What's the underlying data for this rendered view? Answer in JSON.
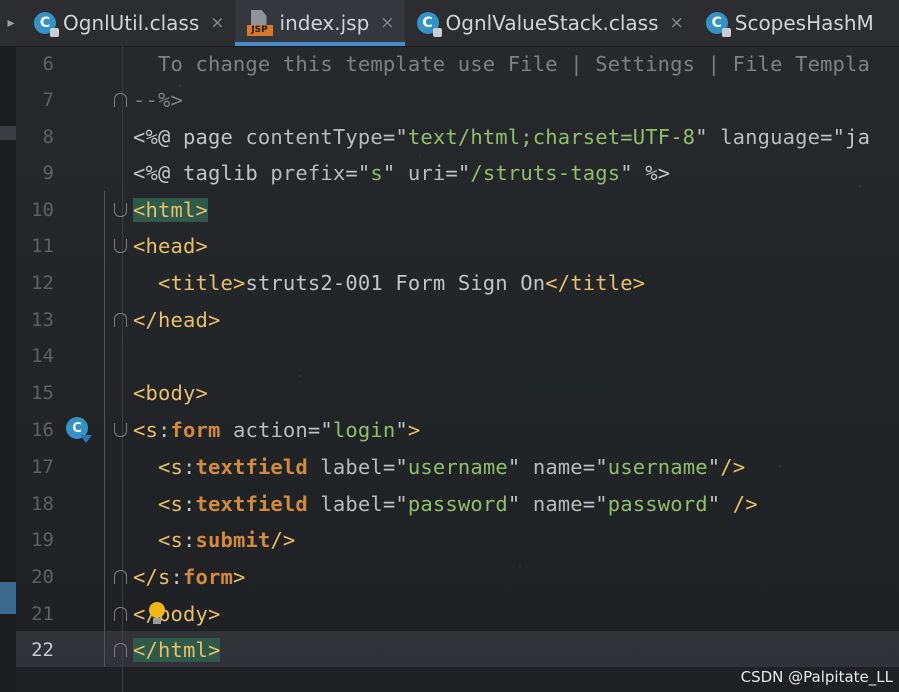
{
  "tabs": [
    {
      "label": "OgnlUtil.class",
      "icon": "class-icon",
      "active": false
    },
    {
      "label": "index.jsp",
      "icon": "jsp-file-icon",
      "active": true
    },
    {
      "label": "OgnlValueStack.class",
      "icon": "class-icon",
      "active": false
    },
    {
      "label": "ScopesHashM",
      "icon": "class-icon",
      "active": false
    }
  ],
  "tab_close_glyph": "×",
  "icons": {
    "class_letter": "C",
    "jsp_badge": "JSP",
    "struts_letter": "C"
  },
  "colors": {
    "accent": "#4a88c7",
    "tag": "#e8bf6a",
    "keyword": "#d28a3e",
    "string": "#8fbf6a"
  },
  "lines": [
    {
      "number": "6",
      "text": "  To change this template use File | Settings | File Templa"
    },
    {
      "number": "7",
      "text": "--%>"
    },
    {
      "number": "8",
      "text": "<%@ page contentType=\"text/html;charset=UTF-8\" language=\"ja"
    },
    {
      "number": "9",
      "text": "<%@ taglib prefix=\"s\" uri=\"/struts-tags\" %>"
    },
    {
      "number": "10",
      "text": "<html>"
    },
    {
      "number": "11",
      "text": "<head>"
    },
    {
      "number": "12",
      "text": "  <title>struts2-001 Form Sign On</title>"
    },
    {
      "number": "13",
      "text": "</head>"
    },
    {
      "number": "14",
      "text": ""
    },
    {
      "number": "15",
      "text": "<body>"
    },
    {
      "number": "16",
      "text": "<s:form action=\"login\">"
    },
    {
      "number": "17",
      "text": "  <s:textfield label=\"username\" name=\"username\"/>"
    },
    {
      "number": "18",
      "text": "  <s:textfield label=\"password\" name=\"password\" />"
    },
    {
      "number": "19",
      "text": "  <s:submit/>"
    },
    {
      "number": "20",
      "text": "</s:form>"
    },
    {
      "number": "21",
      "text": "</body>"
    },
    {
      "number": "22",
      "text": "</html>"
    }
  ],
  "current_line": "22",
  "watermark": "CSDN @Palpitate_LL"
}
